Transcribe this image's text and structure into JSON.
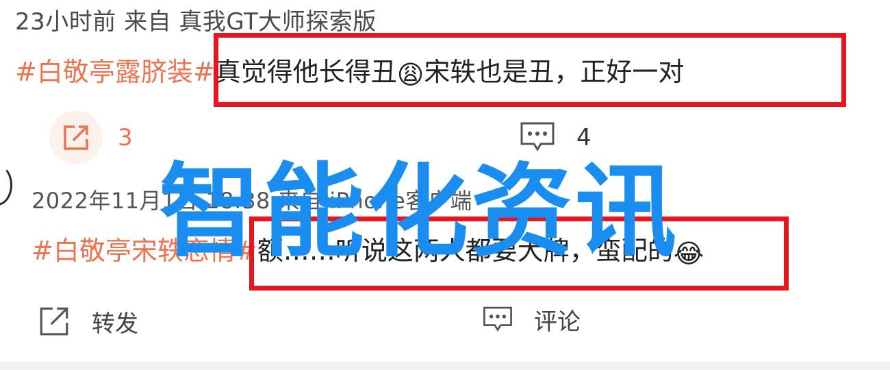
{
  "post1": {
    "meta": "23小时前 来自 真我GT大师探索版",
    "hashtag": "#白敬亭露脐装#",
    "text_before_emoji": "真觉得他长得丑",
    "emoji": "😩",
    "text_after_emoji": "宋轶也是丑，正好一对",
    "share_count": "3",
    "comment_count": "4"
  },
  "post2": {
    "meta": "2022年11月1日 18:38 来自 iPhone客户端",
    "hashtag": "#白敬亭宋轶恋情#",
    "text_before_emoji": "额……听说这两人都要大牌，蛮配的",
    "emoji": "😂",
    "share_label": "转发",
    "comment_label": "评论"
  },
  "watermark": "智能化资讯",
  "colors": {
    "hashtag": "#eb7350",
    "highlight_box": "#e8141e",
    "watermark": "#1a8df0",
    "icon": "#555555",
    "share_icon_active": "#eb7350"
  },
  "icons": {
    "share": "share-arrow-icon",
    "comment": "comment-bubble-icon"
  }
}
